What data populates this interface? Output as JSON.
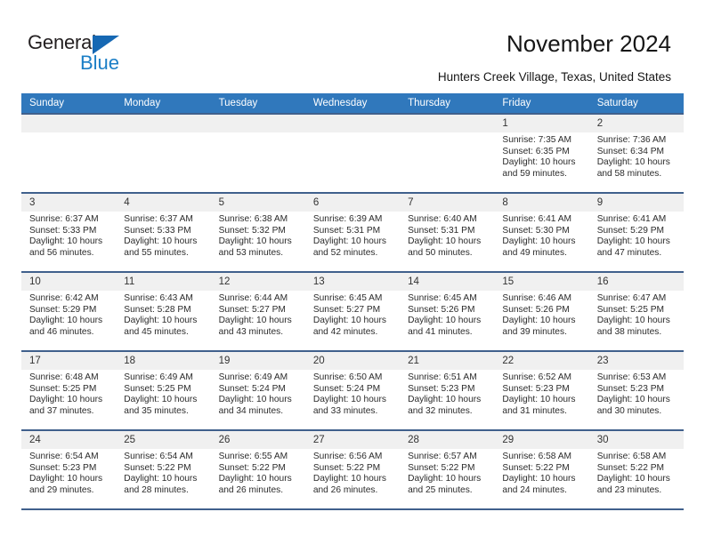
{
  "brand": {
    "name_part1": "General",
    "name_part2": "Blue",
    "accent_color": "#1b7ec6",
    "triangle_color": "#1668b3"
  },
  "header": {
    "title": "November 2024",
    "subtitle": "Hunters Creek Village, Texas, United States"
  },
  "calendar": {
    "header_bg": "#3078bc",
    "weekdays": [
      "Sunday",
      "Monday",
      "Tuesday",
      "Wednesday",
      "Thursday",
      "Friday",
      "Saturday"
    ],
    "weeks": [
      [
        {
          "day": "",
          "blank": true
        },
        {
          "day": "",
          "blank": true
        },
        {
          "day": "",
          "blank": true
        },
        {
          "day": "",
          "blank": true
        },
        {
          "day": "",
          "blank": true
        },
        {
          "day": "1",
          "sunrise": "Sunrise: 7:35 AM",
          "sunset": "Sunset: 6:35 PM",
          "daylight": "Daylight: 10 hours and 59 minutes."
        },
        {
          "day": "2",
          "sunrise": "Sunrise: 7:36 AM",
          "sunset": "Sunset: 6:34 PM",
          "daylight": "Daylight: 10 hours and 58 minutes."
        }
      ],
      [
        {
          "day": "3",
          "sunrise": "Sunrise: 6:37 AM",
          "sunset": "Sunset: 5:33 PM",
          "daylight": "Daylight: 10 hours and 56 minutes."
        },
        {
          "day": "4",
          "sunrise": "Sunrise: 6:37 AM",
          "sunset": "Sunset: 5:33 PM",
          "daylight": "Daylight: 10 hours and 55 minutes."
        },
        {
          "day": "5",
          "sunrise": "Sunrise: 6:38 AM",
          "sunset": "Sunset: 5:32 PM",
          "daylight": "Daylight: 10 hours and 53 minutes."
        },
        {
          "day": "6",
          "sunrise": "Sunrise: 6:39 AM",
          "sunset": "Sunset: 5:31 PM",
          "daylight": "Daylight: 10 hours and 52 minutes."
        },
        {
          "day": "7",
          "sunrise": "Sunrise: 6:40 AM",
          "sunset": "Sunset: 5:31 PM",
          "daylight": "Daylight: 10 hours and 50 minutes."
        },
        {
          "day": "8",
          "sunrise": "Sunrise: 6:41 AM",
          "sunset": "Sunset: 5:30 PM",
          "daylight": "Daylight: 10 hours and 49 minutes."
        },
        {
          "day": "9",
          "sunrise": "Sunrise: 6:41 AM",
          "sunset": "Sunset: 5:29 PM",
          "daylight": "Daylight: 10 hours and 47 minutes."
        }
      ],
      [
        {
          "day": "10",
          "sunrise": "Sunrise: 6:42 AM",
          "sunset": "Sunset: 5:29 PM",
          "daylight": "Daylight: 10 hours and 46 minutes."
        },
        {
          "day": "11",
          "sunrise": "Sunrise: 6:43 AM",
          "sunset": "Sunset: 5:28 PM",
          "daylight": "Daylight: 10 hours and 45 minutes."
        },
        {
          "day": "12",
          "sunrise": "Sunrise: 6:44 AM",
          "sunset": "Sunset: 5:27 PM",
          "daylight": "Daylight: 10 hours and 43 minutes."
        },
        {
          "day": "13",
          "sunrise": "Sunrise: 6:45 AM",
          "sunset": "Sunset: 5:27 PM",
          "daylight": "Daylight: 10 hours and 42 minutes."
        },
        {
          "day": "14",
          "sunrise": "Sunrise: 6:45 AM",
          "sunset": "Sunset: 5:26 PM",
          "daylight": "Daylight: 10 hours and 41 minutes."
        },
        {
          "day": "15",
          "sunrise": "Sunrise: 6:46 AM",
          "sunset": "Sunset: 5:26 PM",
          "daylight": "Daylight: 10 hours and 39 minutes."
        },
        {
          "day": "16",
          "sunrise": "Sunrise: 6:47 AM",
          "sunset": "Sunset: 5:25 PM",
          "daylight": "Daylight: 10 hours and 38 minutes."
        }
      ],
      [
        {
          "day": "17",
          "sunrise": "Sunrise: 6:48 AM",
          "sunset": "Sunset: 5:25 PM",
          "daylight": "Daylight: 10 hours and 37 minutes."
        },
        {
          "day": "18",
          "sunrise": "Sunrise: 6:49 AM",
          "sunset": "Sunset: 5:25 PM",
          "daylight": "Daylight: 10 hours and 35 minutes."
        },
        {
          "day": "19",
          "sunrise": "Sunrise: 6:49 AM",
          "sunset": "Sunset: 5:24 PM",
          "daylight": "Daylight: 10 hours and 34 minutes."
        },
        {
          "day": "20",
          "sunrise": "Sunrise: 6:50 AM",
          "sunset": "Sunset: 5:24 PM",
          "daylight": "Daylight: 10 hours and 33 minutes."
        },
        {
          "day": "21",
          "sunrise": "Sunrise: 6:51 AM",
          "sunset": "Sunset: 5:23 PM",
          "daylight": "Daylight: 10 hours and 32 minutes."
        },
        {
          "day": "22",
          "sunrise": "Sunrise: 6:52 AM",
          "sunset": "Sunset: 5:23 PM",
          "daylight": "Daylight: 10 hours and 31 minutes."
        },
        {
          "day": "23",
          "sunrise": "Sunrise: 6:53 AM",
          "sunset": "Sunset: 5:23 PM",
          "daylight": "Daylight: 10 hours and 30 minutes."
        }
      ],
      [
        {
          "day": "24",
          "sunrise": "Sunrise: 6:54 AM",
          "sunset": "Sunset: 5:23 PM",
          "daylight": "Daylight: 10 hours and 29 minutes."
        },
        {
          "day": "25",
          "sunrise": "Sunrise: 6:54 AM",
          "sunset": "Sunset: 5:22 PM",
          "daylight": "Daylight: 10 hours and 28 minutes."
        },
        {
          "day": "26",
          "sunrise": "Sunrise: 6:55 AM",
          "sunset": "Sunset: 5:22 PM",
          "daylight": "Daylight: 10 hours and 26 minutes."
        },
        {
          "day": "27",
          "sunrise": "Sunrise: 6:56 AM",
          "sunset": "Sunset: 5:22 PM",
          "daylight": "Daylight: 10 hours and 26 minutes."
        },
        {
          "day": "28",
          "sunrise": "Sunrise: 6:57 AM",
          "sunset": "Sunset: 5:22 PM",
          "daylight": "Daylight: 10 hours and 25 minutes."
        },
        {
          "day": "29",
          "sunrise": "Sunrise: 6:58 AM",
          "sunset": "Sunset: 5:22 PM",
          "daylight": "Daylight: 10 hours and 24 minutes."
        },
        {
          "day": "30",
          "sunrise": "Sunrise: 6:58 AM",
          "sunset": "Sunset: 5:22 PM",
          "daylight": "Daylight: 10 hours and 23 minutes."
        }
      ]
    ]
  }
}
